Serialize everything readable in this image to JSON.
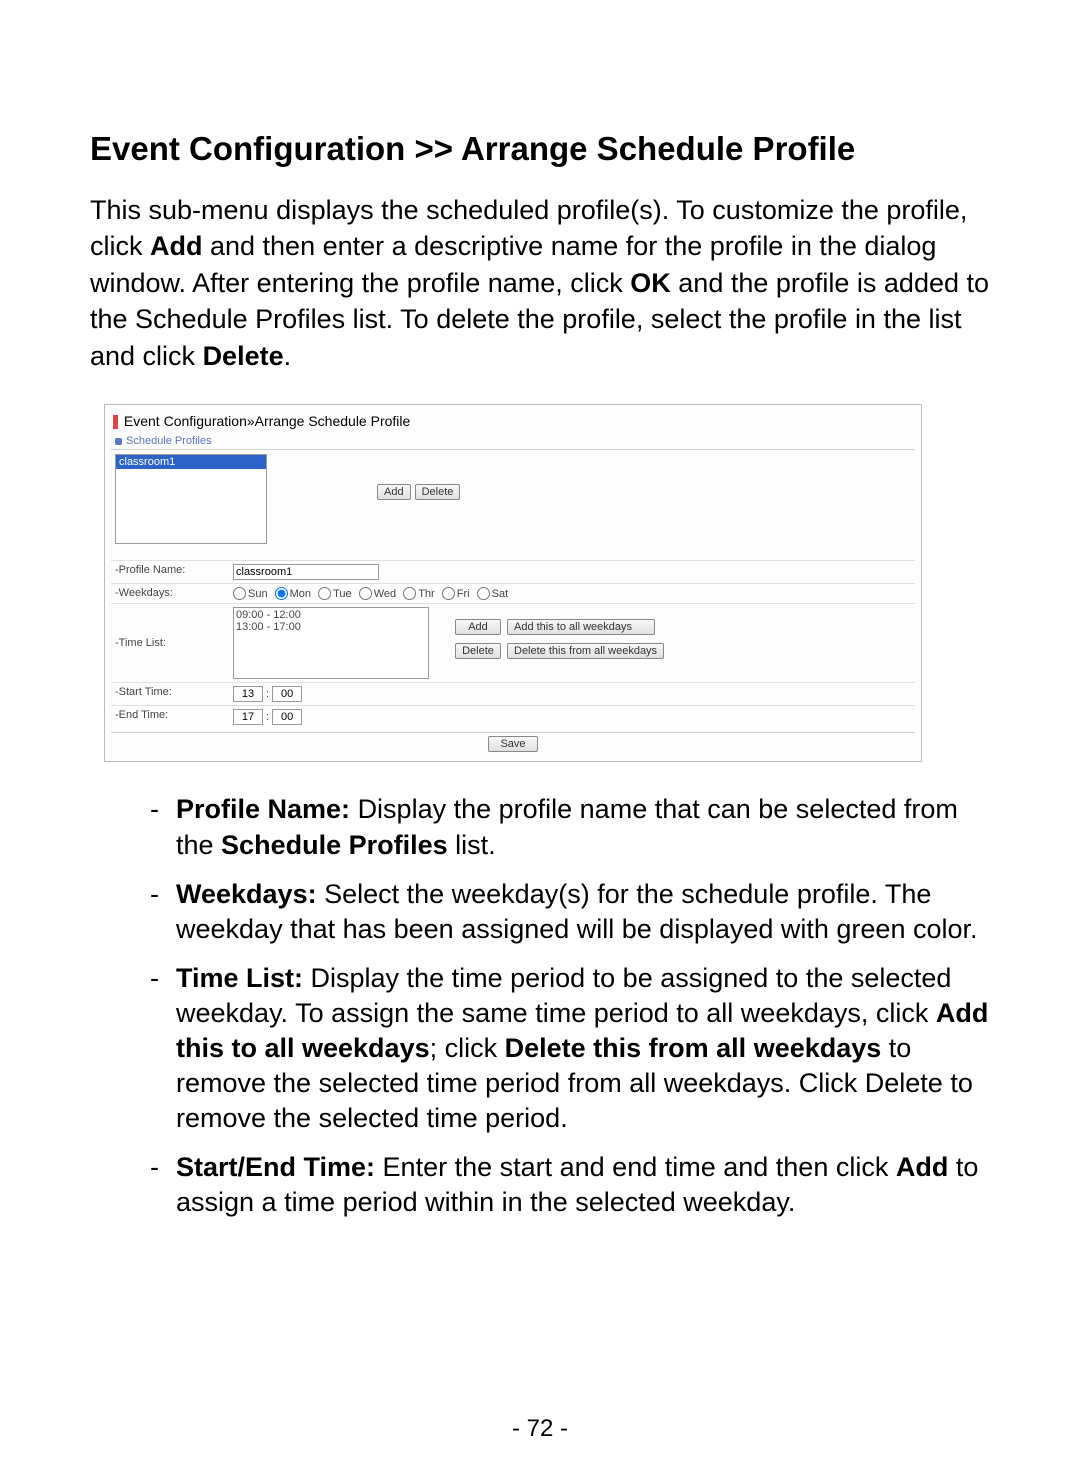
{
  "heading": "Event Configuration >> Arrange Schedule Profile",
  "intro_parts": {
    "p1": "This sub-menu displays the scheduled profile(s). To customize the profile, click ",
    "b1": "Add",
    "p2": " and then enter a descriptive name for the profile in the dialog window. After entering the profile name, click ",
    "b2": "OK",
    "p3": " and the profile is added to the Schedule Profiles list. To delete the profile, select the profile in the list and click ",
    "b3": "Delete",
    "p4": "."
  },
  "fig": {
    "title": "Event Configuration»Arrange Schedule Profile",
    "section_header": "Schedule Profiles",
    "profiles_list_selected": "classroom1",
    "add_btn": "Add",
    "delete_btn": "Delete",
    "labels": {
      "profile_name": "-Profile Name:",
      "weekdays": "-Weekdays:",
      "time_list": "-Time List:",
      "start_time": "-Start Time:",
      "end_time": "-End Time:"
    },
    "profile_name_value": "classroom1",
    "weekdays": {
      "sun": "Sun",
      "mon": "Mon",
      "tue": "Tue",
      "wed": "Wed",
      "thr": "Thr",
      "fri": "Fri",
      "sat": "Sat",
      "selected": "mon"
    },
    "timelist_text": "09:00 - 12:00\n13:00 - 17:00",
    "time_btns": {
      "add": "Add",
      "add_all": "Add this to all weekdays",
      "delete": "Delete",
      "delete_all": "Delete this from all weekdays"
    },
    "start_hh": "13",
    "start_mm": "00",
    "end_hh": "17",
    "end_mm": "00",
    "save_btn": "Save"
  },
  "bullets": {
    "pn": {
      "label": "Profile Name: ",
      "t1": "Display the profile name that can be selected from the ",
      "b1": "Schedule Profiles",
      "t2": " list."
    },
    "wd": {
      "label": "Weekdays: ",
      "t1": "Select the weekday(s) for the schedule profile. The weekday that has been assigned will be displayed with green color."
    },
    "tl": {
      "label": "Time List: ",
      "t1": "Display the time period to be assigned to the selected weekday. To assign the same time period to all weekdays, click ",
      "b1": "Add this to all weekdays",
      "t2": "; click ",
      "b2": "Delete this from all weekdays",
      "t3": " to remove the selected time period from all weekdays. Click Delete to remove the selected time period."
    },
    "st": {
      "label": "Start/End Time: ",
      "t1": "Enter the start and end time and then click ",
      "b1": "Add",
      "t2": " to assign a time period within in the selected weekday."
    }
  },
  "page_number": "- 72 -"
}
